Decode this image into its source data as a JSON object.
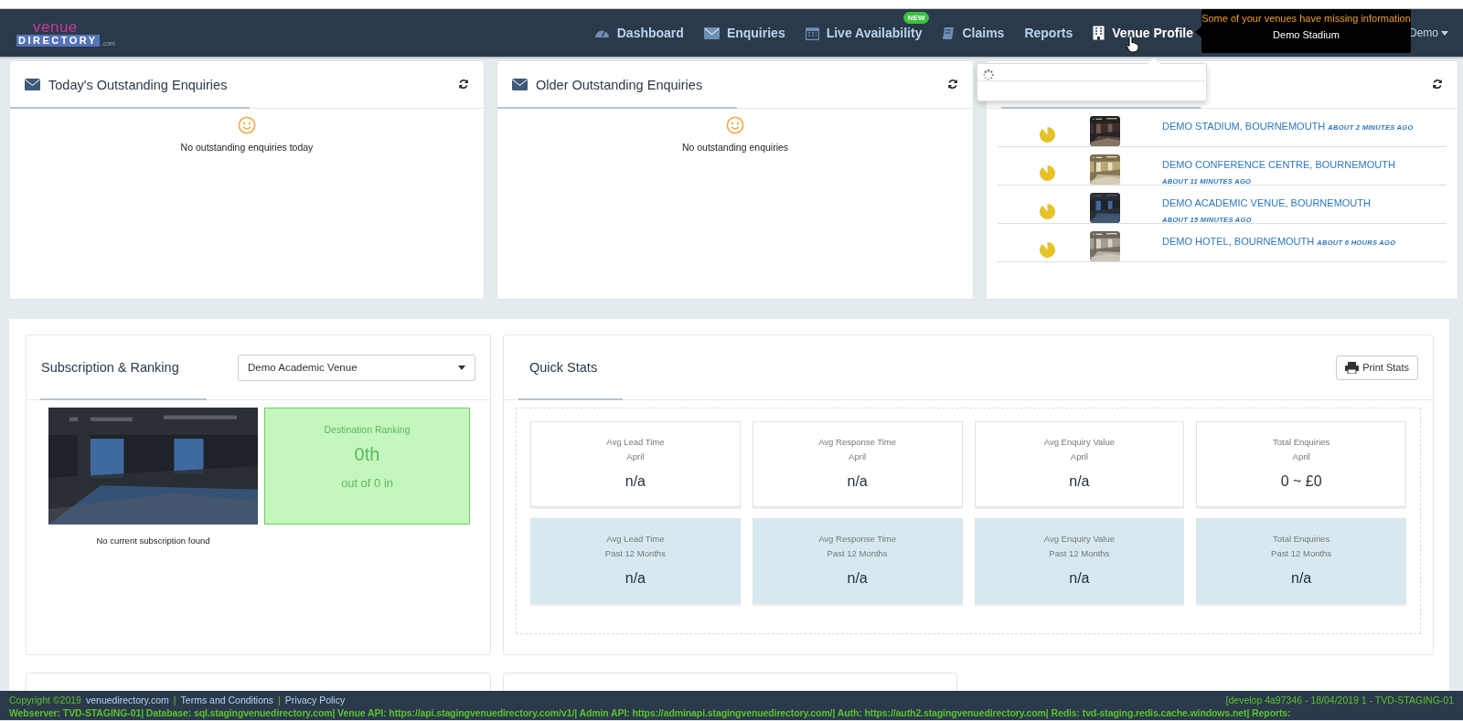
{
  "navbar": {
    "logo_top": "venue",
    "logo_bottom": "DIRECTORY",
    "logo_suffix": ".com",
    "items": [
      {
        "label": "Dashboard",
        "selected": false
      },
      {
        "label": "Enquiries",
        "selected": false
      },
      {
        "label": "Live Availability",
        "selected": false,
        "badge": "NEW"
      },
      {
        "label": "Claims",
        "selected": false
      },
      {
        "label": "Reports",
        "selected": false
      },
      {
        "label": "Venue Profile",
        "selected": true
      }
    ],
    "user": "Demo"
  },
  "tooltip": {
    "title": "Some of your venues have missing information",
    "text": "Demo Stadium"
  },
  "enquiry_panels": [
    {
      "title": "Today's Outstanding Enquiries",
      "message": "No outstanding enquiries today"
    },
    {
      "title": "Older Outstanding Enquiries",
      "message": "No outstanding enquiries"
    }
  ],
  "activity": {
    "items": [
      {
        "venue": "DEMO STADIUM, BOURNEMOUTH",
        "time": "ABOUT 2 MINUTES AGO"
      },
      {
        "venue": "DEMO CONFERENCE CENTRE, BOURNEMOUTH",
        "time": "ABOUT 11 MINUTES AGO"
      },
      {
        "venue": "DEMO ACADEMIC VENUE, BOURNEMOUTH",
        "time": "ABOUT 15 MINUTES AGO"
      },
      {
        "venue": "DEMO HOTEL, BOURNEMOUTH",
        "time": "ABOUT 6 HOURS AGO"
      }
    ]
  },
  "subscription": {
    "title": "Subscription & Ranking",
    "venue_select": "Demo Academic Venue",
    "ranking_label": "Destination Ranking",
    "ranking": "0th",
    "ranking_of": "out of 0 in",
    "caption": "No current subscription found"
  },
  "quick_stats": {
    "title": "Quick Stats",
    "print_button": "Print Stats",
    "cards": [
      {
        "label": "Avg Lead Time",
        "period": "April",
        "value": "n/a",
        "kind": "month"
      },
      {
        "label": "Avg Response Time",
        "period": "April",
        "value": "n/a",
        "kind": "month"
      },
      {
        "label": "Avg Enquiry Value",
        "period": "April",
        "value": "n/a",
        "kind": "month"
      },
      {
        "label": "Total Enquiries",
        "period": "April",
        "value": "0 ~ £0",
        "kind": "month"
      },
      {
        "label": "Avg Lead Time",
        "period": "Past 12 Months",
        "value": "n/a",
        "kind": "year"
      },
      {
        "label": "Avg Response Time",
        "period": "Past 12 Months",
        "value": "n/a",
        "kind": "year"
      },
      {
        "label": "Avg Enquiry Value",
        "period": "Past 12 Months",
        "value": "n/a",
        "kind": "year"
      },
      {
        "label": "Total Enquiries",
        "period": "Past 12 Months",
        "value": "n/a",
        "kind": "year"
      }
    ]
  },
  "footer": {
    "copyright": "Copyright ©2019",
    "site": "venuedirectory.com",
    "links": [
      {
        "separator": "|",
        "label": "Terms and Conditions"
      },
      {
        "separator": "|",
        "label": "Privacy Policy"
      }
    ],
    "build": "[develop 4a97346 - 18/04/2019 1 - TVD-STAGING-01",
    "servers": [
      {
        "label": "Webserver:",
        "value": "TVD-STAGING-01|"
      },
      {
        "label": "Database:",
        "value": "sql.stagingvenuedirectory.com|"
      },
      {
        "label": "Venue API:",
        "value": "https://api.stagingvenuedirectory.com/v1/|"
      },
      {
        "label": "Admin API:",
        "value": "https://adminapi.stagingvenuedirectory.com/|"
      },
      {
        "label": "Auth:",
        "value": "https://auth2.stagingvenuedirectory.com|"
      },
      {
        "label": "Redis:",
        "value": "tvd-staging.redis.cache.windows.net|"
      },
      {
        "label": "Reports:"
      }
    ]
  }
}
